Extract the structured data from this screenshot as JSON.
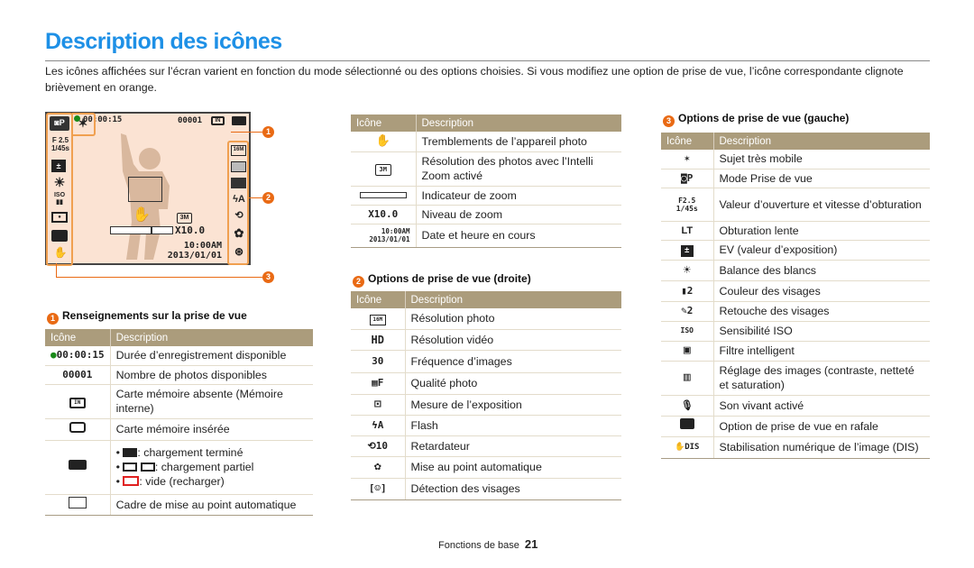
{
  "page": {
    "title": "Description des icônes",
    "intro": "Les icônes affichées sur l’écran varient en fonction du mode sélectionné ou des options choisies. Si vous modifiez une option de prise de vue, l’icône correspondante clignote brièvement en orange."
  },
  "screen": {
    "record_time": "00:00:15",
    "photo_count": "00001",
    "memory_icon": "IN",
    "aperture": "F 2.5",
    "shutter": "1/45s",
    "resolution_3m": "3M",
    "zoom_level": "X10.0",
    "time": "10:00AM",
    "date": "2013/01/01",
    "left_icons": [
      "camera-program-icon",
      "f-value",
      "ev-icon",
      "white-balance-icon",
      "iso-icon",
      "smart-filter-icon",
      "burst-icon",
      "dis-icon"
    ],
    "right_icons": [
      "16m-icon",
      "quality-icon",
      "metering-icon",
      "flash-auto-icon",
      "timer-10-icon",
      "macro-icon",
      "face-detect-icon"
    ],
    "callouts": [
      "1",
      "2",
      "3"
    ]
  },
  "section1": {
    "number": "1",
    "title": "Renseignements sur la prise de vue",
    "header": {
      "icon": "Icône",
      "desc": "Description"
    },
    "rows": [
      {
        "icon": "● 00:00:15",
        "icon_name": "record-time-icon",
        "desc": "Durée d’enregistrement disponible"
      },
      {
        "icon": "00001",
        "icon_name": "photo-count-icon",
        "desc": "Nombre de photos disponibles"
      },
      {
        "icon": "[IN]",
        "icon_name": "internal-memory-icon",
        "desc": "Carte mémoire absente (Mémoire interne)"
      },
      {
        "icon": "▭",
        "icon_name": "memory-card-icon",
        "desc": "Carte mémoire insérée"
      },
      {
        "icon": "▮▮▮",
        "icon_name": "battery-icon",
        "desc_list": [
          ": chargement terminé",
          ": chargement partiel",
          ": vide (recharger)"
        ]
      },
      {
        "icon": "□",
        "icon_name": "af-frame-icon",
        "desc": "Cadre de mise au point automatique"
      }
    ]
  },
  "section_mid": {
    "header": {
      "icon": "Icône",
      "desc": "Description"
    },
    "rows": [
      {
        "icon": "✋",
        "icon_name": "camera-shake-icon",
        "desc": "Tremblements de l’appareil photo"
      },
      {
        "icon": "3M",
        "icon_name": "intelli-zoom-resolution-icon",
        "desc": "Résolution des photos avec l’Intelli Zoom activé"
      },
      {
        "icon": "▭▭▭",
        "icon_name": "zoom-indicator-icon",
        "desc": "Indicateur de zoom"
      },
      {
        "icon": "X10.0",
        "icon_name": "zoom-level-icon",
        "desc": "Niveau de zoom"
      },
      {
        "icon": "10:00AM 2013/01/01",
        "icon_name": "date-time-icon",
        "desc": "Date et heure en cours"
      }
    ]
  },
  "section2": {
    "number": "2",
    "title": "Options de prise de vue (droite)",
    "header": {
      "icon": "Icône",
      "desc": "Description"
    },
    "rows": [
      {
        "icon": "16M",
        "icon_name": "photo-resolution-icon",
        "desc": "Résolution photo"
      },
      {
        "icon": "HD",
        "icon_name": "video-resolution-icon",
        "desc": "Résolution vidéo"
      },
      {
        "icon": "30",
        "icon_name": "frame-rate-icon",
        "desc": "Fréquence d’images"
      },
      {
        "icon": "▦F",
        "icon_name": "photo-quality-icon",
        "desc": "Qualité photo"
      },
      {
        "icon": "⊡",
        "icon_name": "metering-icon",
        "desc": "Mesure de l’exposition"
      },
      {
        "icon": "ϟA",
        "icon_name": "flash-icon",
        "desc": "Flash"
      },
      {
        "icon": "⟲10",
        "icon_name": "timer-icon",
        "desc": "Retardateur"
      },
      {
        "icon": "✿",
        "icon_name": "autofocus-icon",
        "desc": "Mise au point automatique"
      },
      {
        "icon": "[☺]",
        "icon_name": "face-detection-icon",
        "desc": "Détection des visages"
      }
    ]
  },
  "section3": {
    "number": "3",
    "title": "Options de prise de vue (gauche)",
    "header": {
      "icon": "Icône",
      "desc": "Description"
    },
    "rows": [
      {
        "icon": "🏃",
        "icon_name": "high-speed-subject-icon",
        "desc": "Sujet très mobile"
      },
      {
        "icon": "◙P",
        "icon_name": "shooting-mode-icon",
        "desc": "Mode Prise de vue"
      },
      {
        "icon": "F2.5 1/45s",
        "icon_name": "aperture-shutter-icon",
        "desc": "Valeur d’ouverture et vitesse d’obturation"
      },
      {
        "icon": "LT",
        "icon_name": "long-time-icon",
        "desc": "Obturation lente"
      },
      {
        "icon": "±",
        "icon_name": "ev-icon",
        "desc": "EV (valeur d’exposition)"
      },
      {
        "icon": "☀",
        "icon_name": "white-balance-icon",
        "desc": "Balance des blancs"
      },
      {
        "icon": "▮2",
        "icon_name": "face-tone-icon",
        "desc": "Couleur des visages"
      },
      {
        "icon": "✎2",
        "icon_name": "face-retouch-icon",
        "desc": "Retouche des visages"
      },
      {
        "icon": "ISO",
        "icon_name": "iso-icon",
        "desc": "Sensibilité ISO"
      },
      {
        "icon": "▣",
        "icon_name": "smart-filter-icon",
        "desc": "Filtre intelligent"
      },
      {
        "icon": "▥",
        "icon_name": "image-adjust-icon",
        "desc": "Réglage des images (contraste, netteté et saturation)"
      },
      {
        "icon": "🎙",
        "icon_name": "live-sound-icon",
        "desc": "Son vivant activé"
      },
      {
        "icon": "▬",
        "icon_name": "burst-icon",
        "desc": "Option de prise de vue en rafale"
      },
      {
        "icon": "✋DIS",
        "icon_name": "dis-icon",
        "desc": "Stabilisation numérique de l’image (DIS)"
      }
    ]
  },
  "footer": {
    "label": "Fonctions de base",
    "page": "21"
  }
}
